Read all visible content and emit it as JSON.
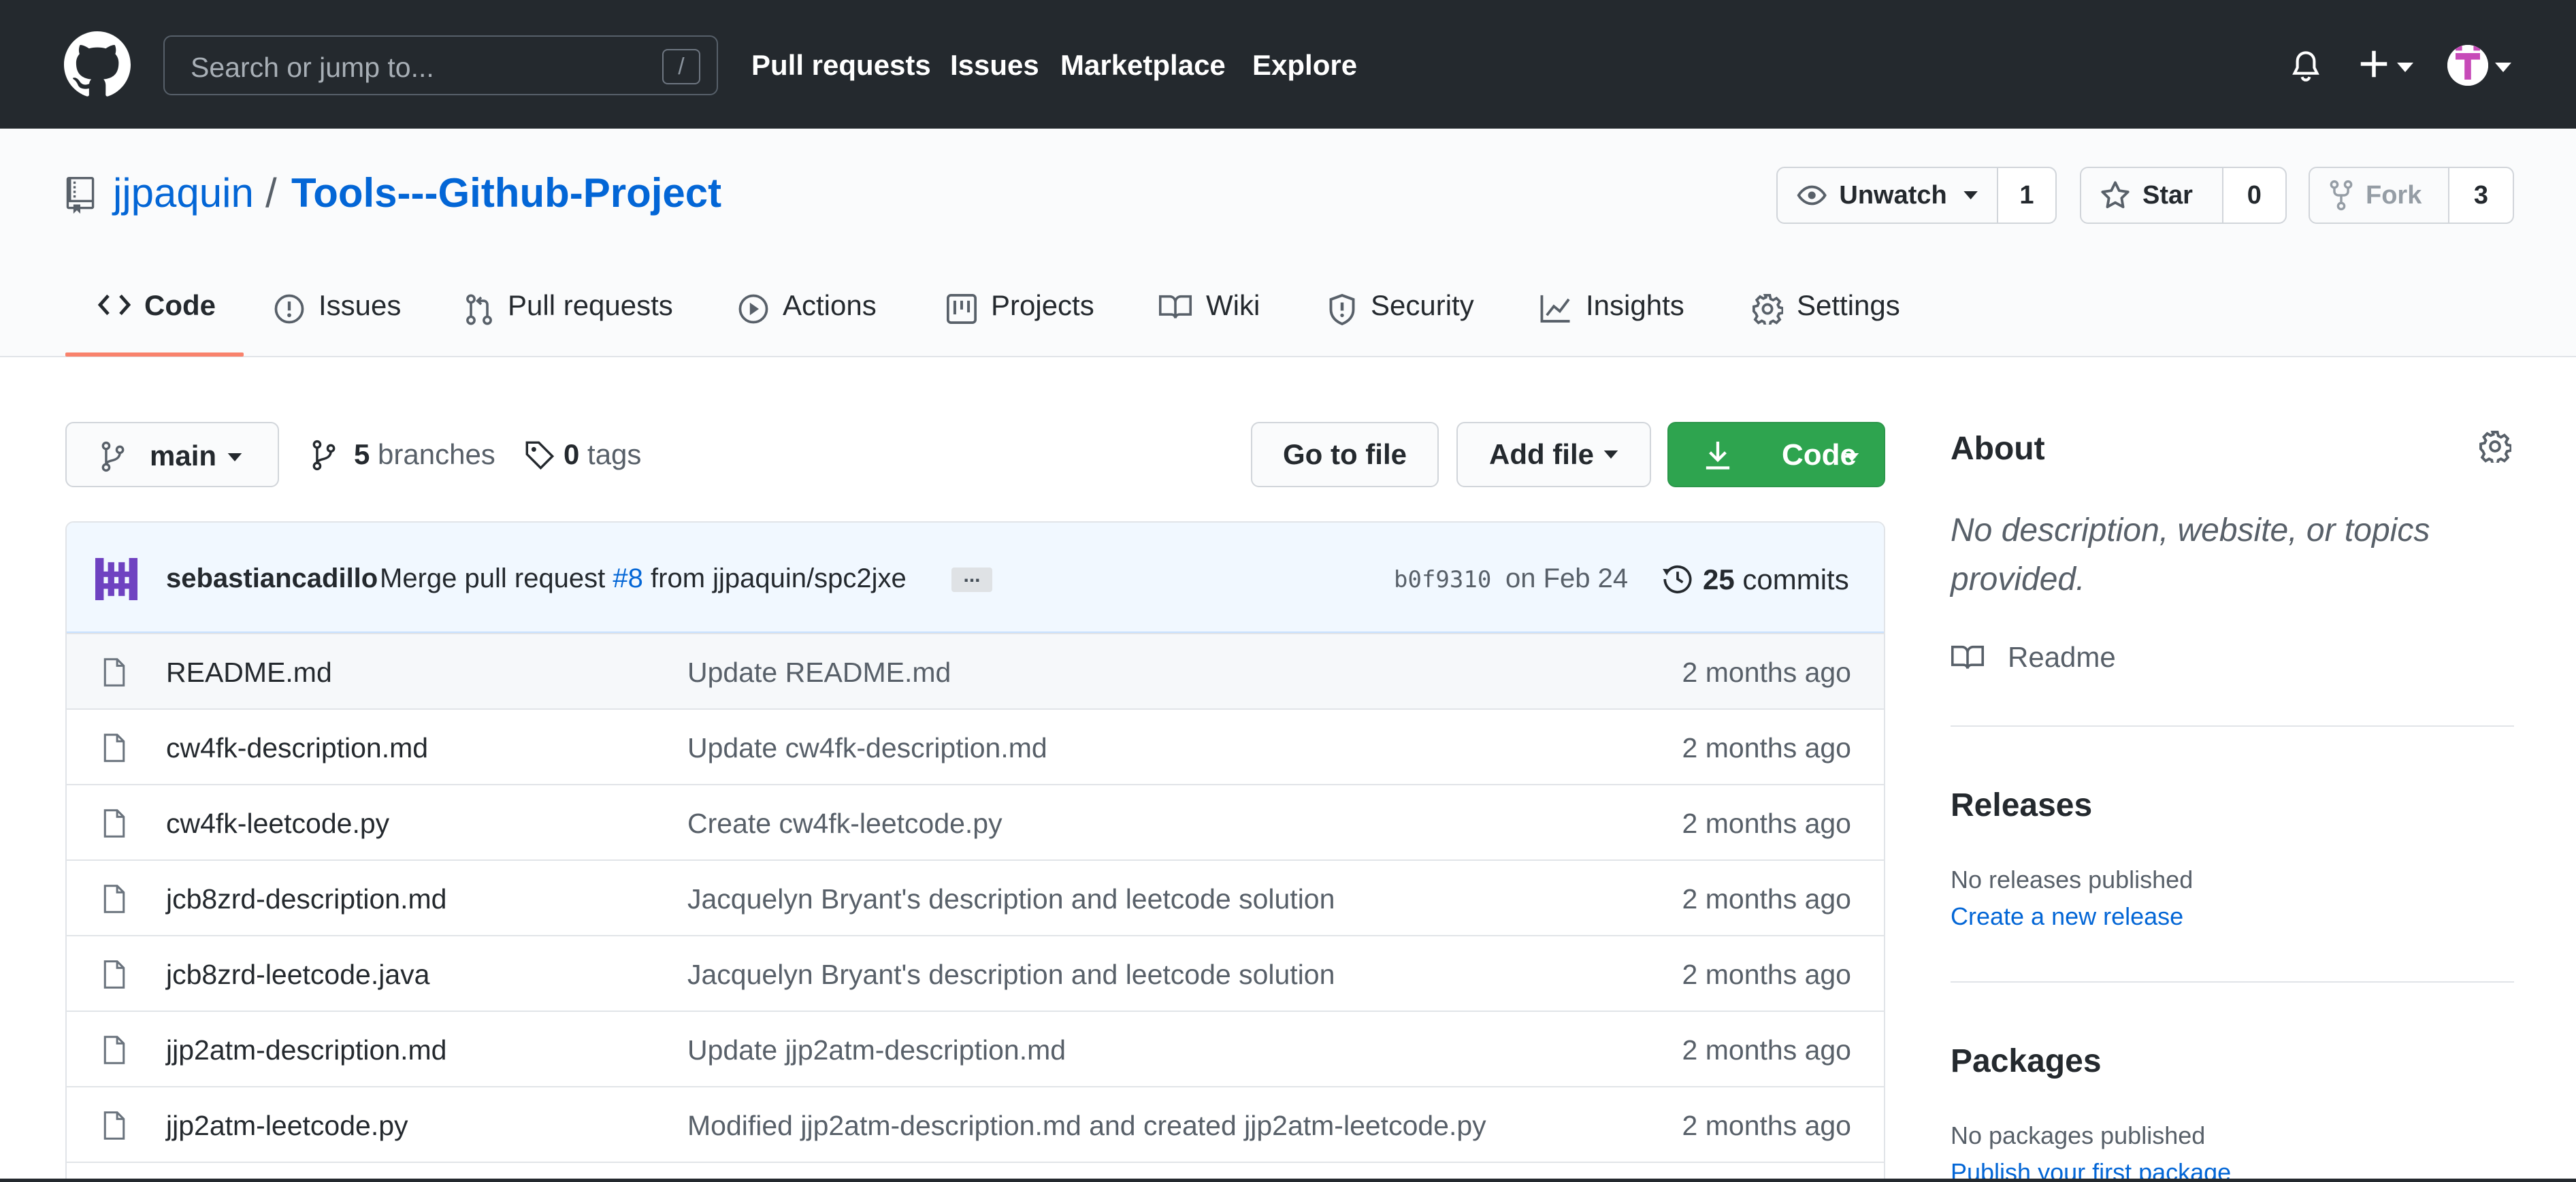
{
  "header": {
    "search_placeholder": "Search or jump to...",
    "search_shortcut": "/",
    "nav": [
      "Pull requests",
      "Issues",
      "Marketplace",
      "Explore"
    ]
  },
  "repo": {
    "owner": "jjpaquin",
    "separator": "/",
    "name": "Tools---Github-Project",
    "watch_label": "Unwatch",
    "watch_count": "1",
    "star_label": "Star",
    "star_count": "0",
    "fork_label": "Fork",
    "fork_count": "3"
  },
  "tabs": [
    {
      "label": "Code",
      "icon": "code-icon",
      "active": true
    },
    {
      "label": "Issues",
      "icon": "issue-icon"
    },
    {
      "label": "Pull requests",
      "icon": "pull-request-icon"
    },
    {
      "label": "Actions",
      "icon": "play-icon"
    },
    {
      "label": "Projects",
      "icon": "project-icon"
    },
    {
      "label": "Wiki",
      "icon": "book-icon"
    },
    {
      "label": "Security",
      "icon": "shield-icon"
    },
    {
      "label": "Insights",
      "icon": "graph-icon"
    },
    {
      "label": "Settings",
      "icon": "gear-icon"
    }
  ],
  "toolbar": {
    "branch": "main",
    "branches_count": "5",
    "branches_label": "branches",
    "tags_count": "0",
    "tags_label": "tags",
    "go_to_file": "Go to file",
    "add_file": "Add file",
    "code": "Code"
  },
  "commit": {
    "author": "sebastiancadillo",
    "message_prefix": "Merge pull request",
    "pr": "#8",
    "message_suffix": "from jjpaquin/spc2jxe",
    "ellipsis": "...",
    "sha": "b0f9310",
    "date": "on Feb 24",
    "commits_count": "25",
    "commits_label": "commits"
  },
  "files": [
    {
      "name": "README.md",
      "message": "Update README.md",
      "age": "2 months ago"
    },
    {
      "name": "cw4fk-description.md",
      "message": "Update cw4fk-description.md",
      "age": "2 months ago"
    },
    {
      "name": "cw4fk-leetcode.py",
      "message": "Create cw4fk-leetcode.py",
      "age": "2 months ago"
    },
    {
      "name": "jcb8zrd-description.md",
      "message": "Jacquelyn Bryant's description and leetcode solution",
      "age": "2 months ago"
    },
    {
      "name": "jcb8zrd-leetcode.java",
      "message": "Jacquelyn Bryant's description and leetcode solution",
      "age": "2 months ago"
    },
    {
      "name": "jjp2atm-description.md",
      "message": "Update jjp2atm-description.md",
      "age": "2 months ago"
    },
    {
      "name": "jjp2atm-leetcode.py",
      "message": "Modified jjp2atm-description.md and created jjp2atm-leetcode.py",
      "age": "2 months ago"
    }
  ],
  "sidebar": {
    "about_title": "About",
    "about_desc": "No description, website, or topics provided.",
    "readme": "Readme",
    "releases_title": "Releases",
    "releases_note": "No releases published",
    "releases_link": "Create a new release",
    "packages_title": "Packages",
    "packages_note": "No packages published",
    "packages_link": "Publish your first package"
  },
  "colors": {
    "header_bg": "#24292e",
    "link": "#0366d6",
    "primary_button": "#2ea44f",
    "active_tab_underline": "#f9826c"
  }
}
